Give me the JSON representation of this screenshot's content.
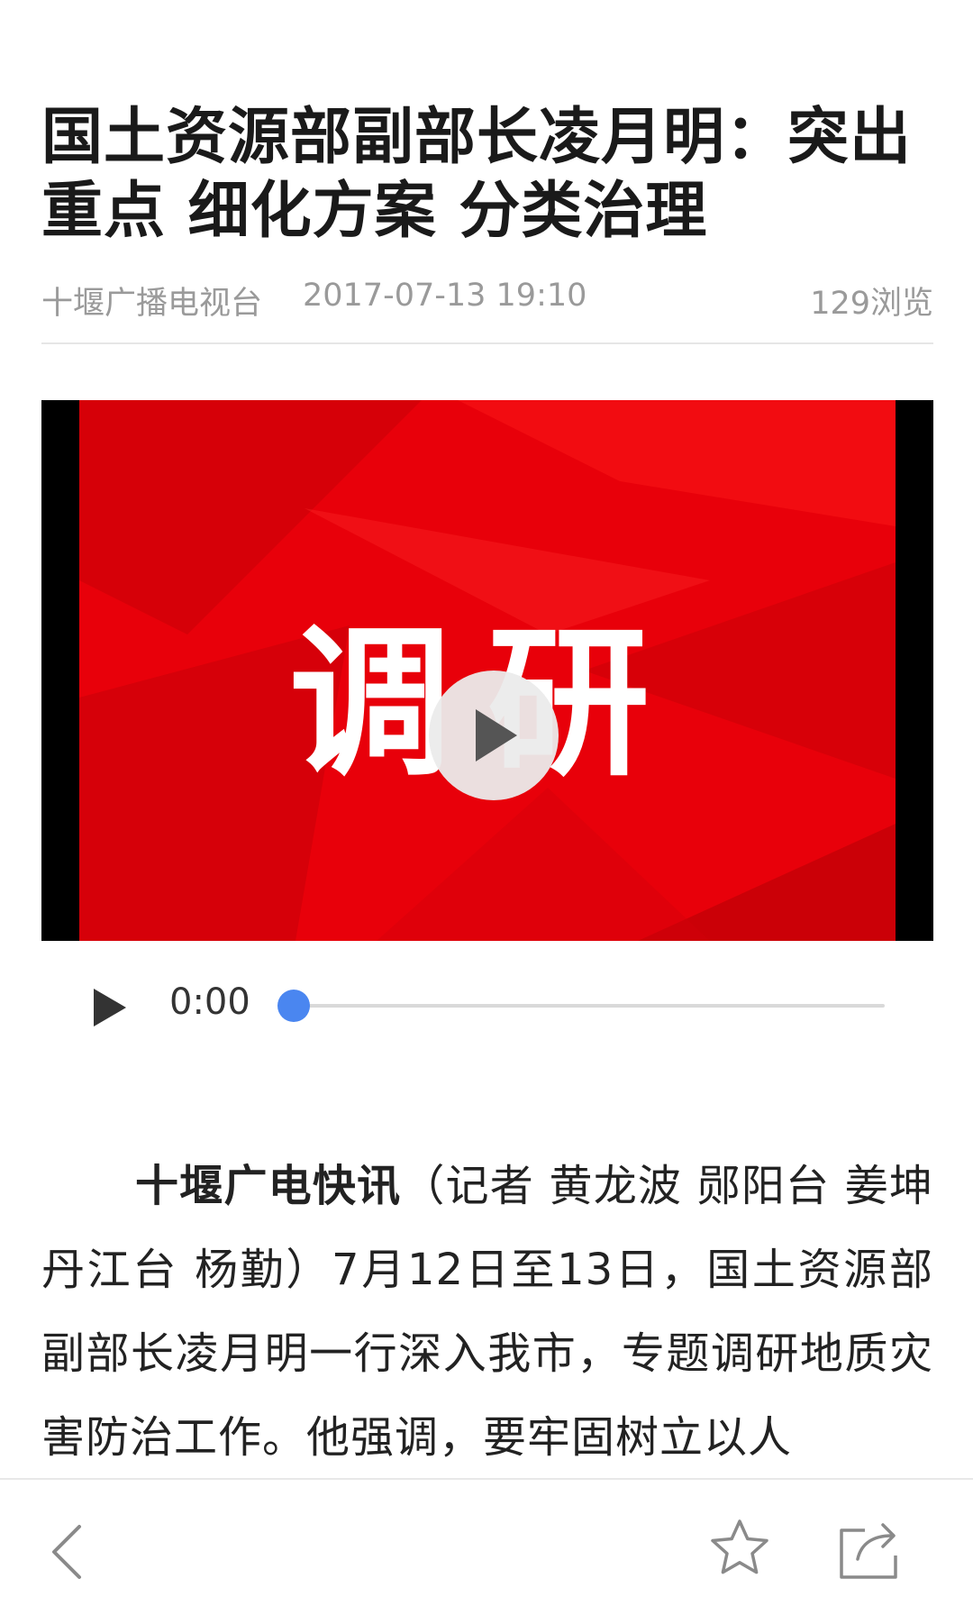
{
  "article": {
    "title": "国土资源部副部长凌月明：突出重点 细化方案 分类治理",
    "source": "十堰广播电视台",
    "datetime": "2017-07-13 19:10",
    "views": "129浏览"
  },
  "video": {
    "overlay_text": "调研",
    "current_time": "0:00",
    "progress": 0,
    "colors": {
      "background": "#e8000a",
      "slider": "#4a86f0"
    }
  },
  "body": {
    "lead": "十堰广电快讯",
    "text": "（记者 黄龙波 郧阳台 姜坤 丹江台 杨勤）7月12日至13日，国土资源部副部长凌月明一行深入我市，专题调研地质灾害防治工作。他强调，要牢固树立以人"
  },
  "toolbar": {
    "icons": [
      "back-chevron-icon",
      "star-icon",
      "share-icon"
    ]
  }
}
